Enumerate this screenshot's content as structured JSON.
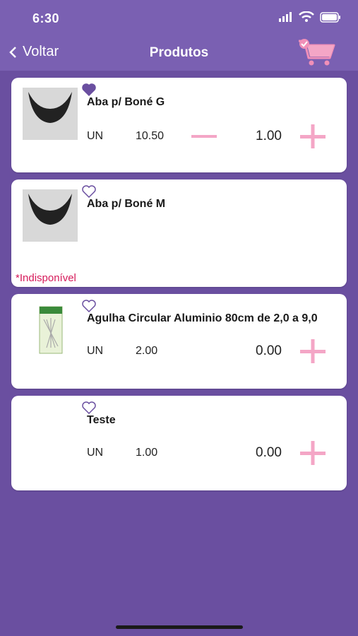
{
  "status": {
    "time": "6:30"
  },
  "nav": {
    "back_label": "Voltar",
    "title": "Produtos"
  },
  "products": [
    {
      "name": "Aba p/ Boné G",
      "unit": "UN",
      "price": "10.50",
      "quantity": "1.00",
      "favorite": true
    },
    {
      "name": "Aba p/ Boné M",
      "unavailable": "*Indisponível",
      "favorite": false
    },
    {
      "name": "Agulha Circular Aluminio 80cm de 2,0 a 9,0",
      "unit": "UN",
      "price": "2.00",
      "quantity": "0.00",
      "favorite": false
    },
    {
      "name": "Teste",
      "unit": "UN",
      "price": "1.00",
      "quantity": "0.00",
      "favorite": false
    }
  ],
  "colors": {
    "accent": "#7a60b2",
    "background": "#6a4fa0",
    "pink": "#f4a6c6",
    "alert": "#d61a5a"
  },
  "icons": [
    "back-chevron-icon",
    "cart-icon",
    "heart-icon",
    "minus-icon",
    "plus-icon",
    "wifi-icon",
    "battery-icon",
    "signal-icon"
  ]
}
